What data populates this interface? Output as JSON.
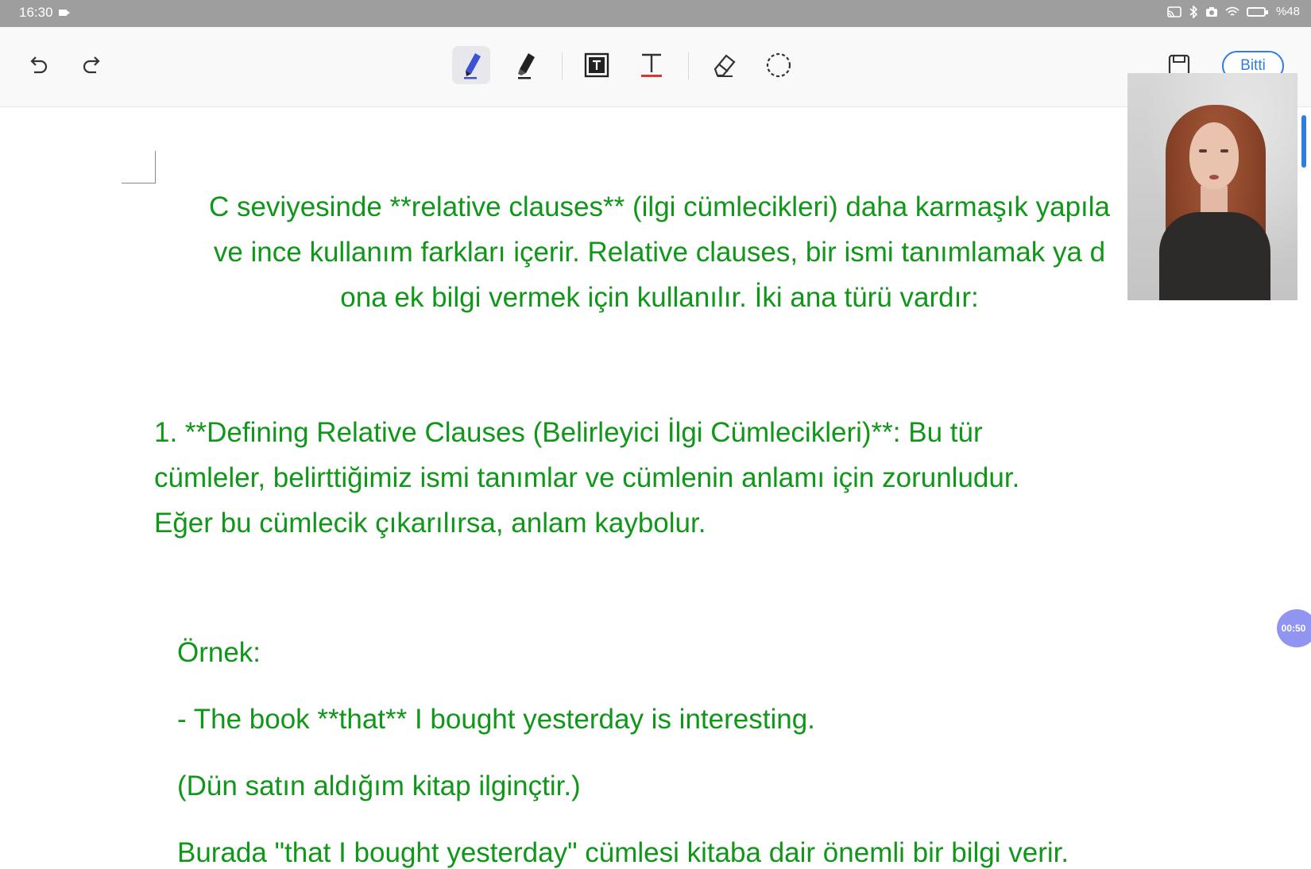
{
  "status_bar": {
    "time": "16:30",
    "battery_text": "%48"
  },
  "toolbar": {
    "done_label": "Bitti",
    "tools": [
      "undo-icon",
      "redo-icon",
      "pen-icon",
      "highlighter-icon",
      "text-box-icon",
      "text-icon",
      "eraser-icon",
      "lasso-icon",
      "save-icon"
    ]
  },
  "document": {
    "intro_lines": [
      "C seviyesinde **relative clauses** (ilgi cümlecikleri) daha karmaşık yapıla",
      "ve ince kullanım farkları içerir. Relative clauses, bir ismi tanımlamak ya d",
      "ona ek bilgi vermek için kullanılır. İki ana türü vardır:"
    ],
    "section_lines": [
      "1. **Defining Relative Clauses (Belirleyici İlgi Cümlecikleri)**: Bu tür",
      "cümleler, belirttiğimiz ismi tanımlar ve cümlenin anlamı için zorunludur.",
      "Eğer bu cümlecik çıkarılırsa, anlam kaybolur."
    ],
    "example_title": "Örnek:",
    "example_sentence": "- The book **that** I bought yesterday is interesting.",
    "example_translation": "(Dün satın aldığım kitap ilginçtir.)",
    "explanation_partial": "Burada \"that I bought yesterday\" cümlesi kitaba dair önemli bir bilgi verir."
  },
  "recording": {
    "timer": "00:50"
  },
  "colors": {
    "text_green": "#109619",
    "accent_blue": "#2f7de1",
    "statusbar_gray": "#9e9e9e"
  }
}
